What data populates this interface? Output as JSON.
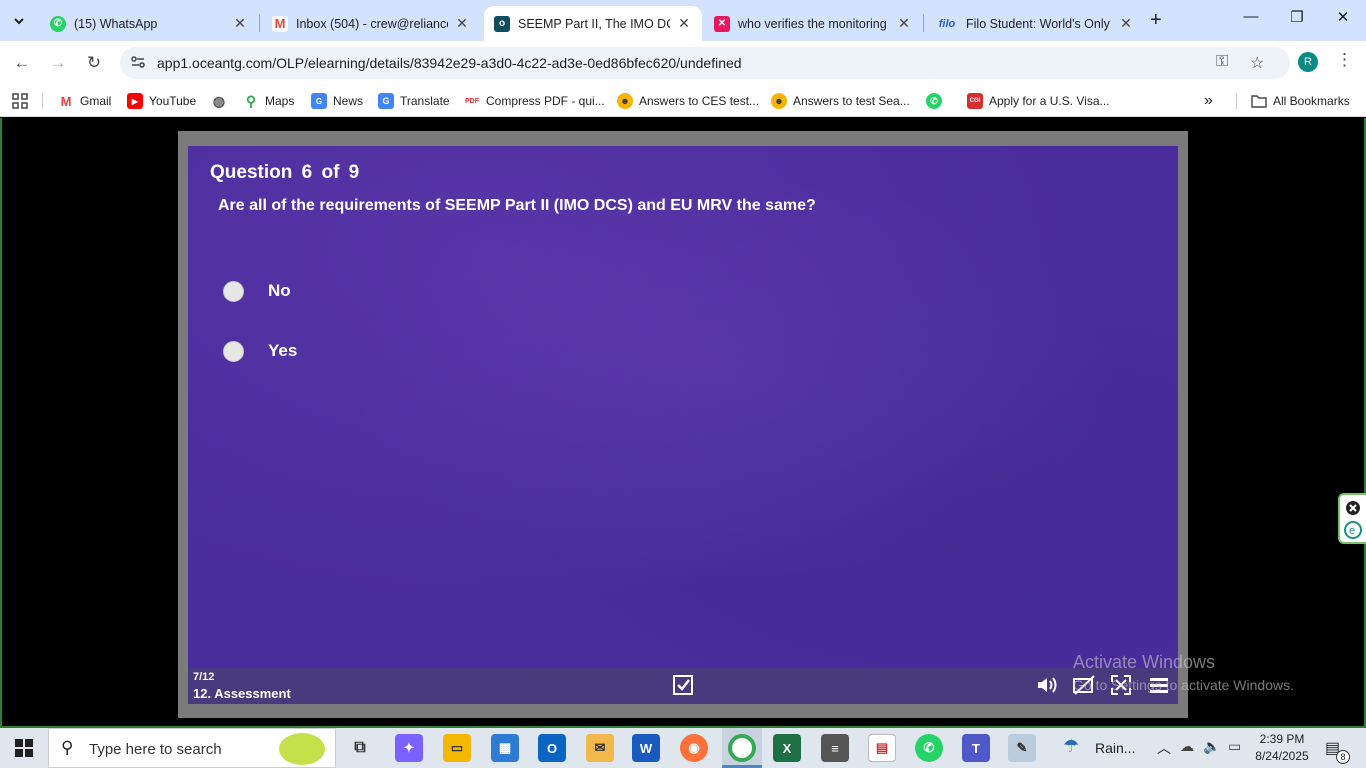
{
  "tabs": [
    {
      "label": "(15) WhatsApp",
      "icon": "whatsapp-icon",
      "color": "#25d366"
    },
    {
      "label": "Inbox (504) - crew@relianceg",
      "icon": "gmail-icon",
      "color": "#ea4335"
    },
    {
      "label": "SEEMP Part II, The IMO DCS",
      "icon": "oceantg-icon",
      "color": "#0f4c5c"
    },
    {
      "label": "who verifies the monitoring",
      "icon": "x-close-brand-icon",
      "color": "#e8175d"
    },
    {
      "label": "Filo Student: World's Only Li",
      "icon": "filo-icon",
      "color": "#2a5bd7"
    }
  ],
  "filo_fav_text": "filo",
  "address": {
    "url": "app1.oceantg.com/OLP/elearning/details/83942e29-a3d0-4c22-ad3e-0ed86bfec620/undefined",
    "profile_initial": "R"
  },
  "bookmarks": {
    "items": [
      {
        "label": "Gmail",
        "icon": "gmail-icon"
      },
      {
        "label": "YouTube",
        "icon": "youtube-icon"
      },
      {
        "label": "",
        "icon": "globe-icon"
      },
      {
        "label": "Maps",
        "icon": "maps-icon"
      },
      {
        "label": "News",
        "icon": "news-icon"
      },
      {
        "label": "Translate",
        "icon": "translate-icon"
      },
      {
        "label": "Compress PDF - qui...",
        "icon": "pdf24-icon"
      },
      {
        "label": "Answers to CES test...",
        "icon": "ces-icon"
      },
      {
        "label": "Answers to test Sea...",
        "icon": "ces-icon"
      },
      {
        "label": "",
        "icon": "whatsapp-icon"
      },
      {
        "label": "Apply for a U.S. Visa...",
        "icon": "cgi-icon"
      }
    ],
    "all_bookmarks": "All Bookmarks",
    "pdf_badge": "PDF",
    "cgi_badge": "CGI"
  },
  "quiz": {
    "question_title": "Question  6  of  9",
    "question_text": "Are all of the requirements of SEEMP Part II (IMO DCS) and EU MRV the same?",
    "options": [
      "No",
      "Yes"
    ],
    "slide_counter": "7/12",
    "slide_name": "12. Assessment"
  },
  "watermark": {
    "line1": "Activate Windows",
    "line2": "Go to Settings to activate Windows."
  },
  "taskbar": {
    "search_placeholder": "Type here to search",
    "weather": "Rain...",
    "time": "2:39 PM",
    "date": "8/24/2025",
    "notifications": "8"
  }
}
